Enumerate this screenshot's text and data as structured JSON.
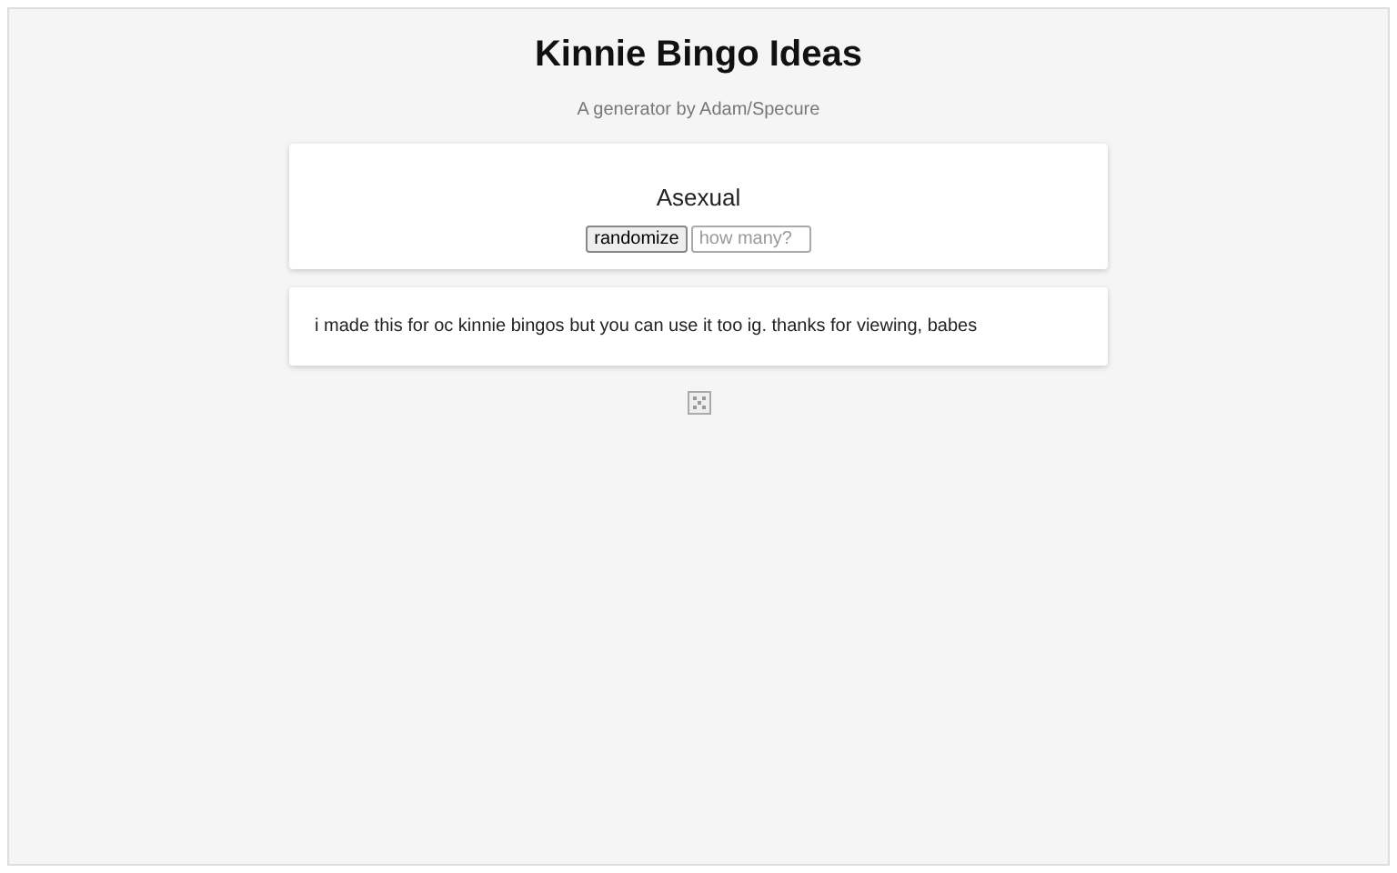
{
  "title": "Kinnie Bingo Ideas",
  "subtitle": "A generator by Adam/Specure",
  "generator": {
    "result": "Asexual",
    "button": "randomize",
    "count_field": {
      "placeholder": "how many?"
    }
  },
  "note": "i made this for oc kinnie bingos but you can use it too ig. thanks for viewing, babes"
}
